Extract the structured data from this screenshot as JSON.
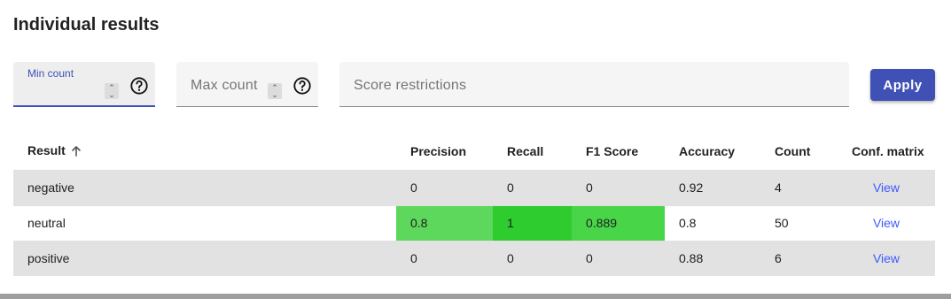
{
  "title": "Individual results",
  "filters": {
    "min_count": {
      "label": "Min count",
      "value": ""
    },
    "max_count": {
      "placeholder": "Max count"
    },
    "score_restrictions": {
      "placeholder": "Score restrictions"
    }
  },
  "apply_label": "Apply",
  "icons": {
    "help": "help-circle-icon",
    "sort": "arrow-up-icon",
    "spinner": "number-spinner-icon"
  },
  "highlight_colors": {
    "medium": "#5dd85d",
    "strong": "#2ecc2e",
    "high": "#48d648",
    "shade_row": "#e2e2e2",
    "accent": "#3f51b5",
    "link": "#3d5afe"
  },
  "table": {
    "columns": [
      "Result",
      "Precision",
      "Recall",
      "F1 Score",
      "Accuracy",
      "Count",
      "Conf. matrix"
    ],
    "sort": {
      "column": "Result",
      "direction": "ascending"
    },
    "rows": [
      {
        "result": "negative",
        "precision": "0",
        "recall": "0",
        "f1": "0",
        "accuracy": "0.92",
        "count": "4",
        "conf_matrix": "View"
      },
      {
        "result": "neutral",
        "precision": "0.8",
        "recall": "1",
        "f1": "0.889",
        "accuracy": "0.8",
        "count": "50",
        "conf_matrix": "View"
      },
      {
        "result": "positive",
        "precision": "0",
        "recall": "0",
        "f1": "0",
        "accuracy": "0.88",
        "count": "6",
        "conf_matrix": "View"
      }
    ]
  }
}
